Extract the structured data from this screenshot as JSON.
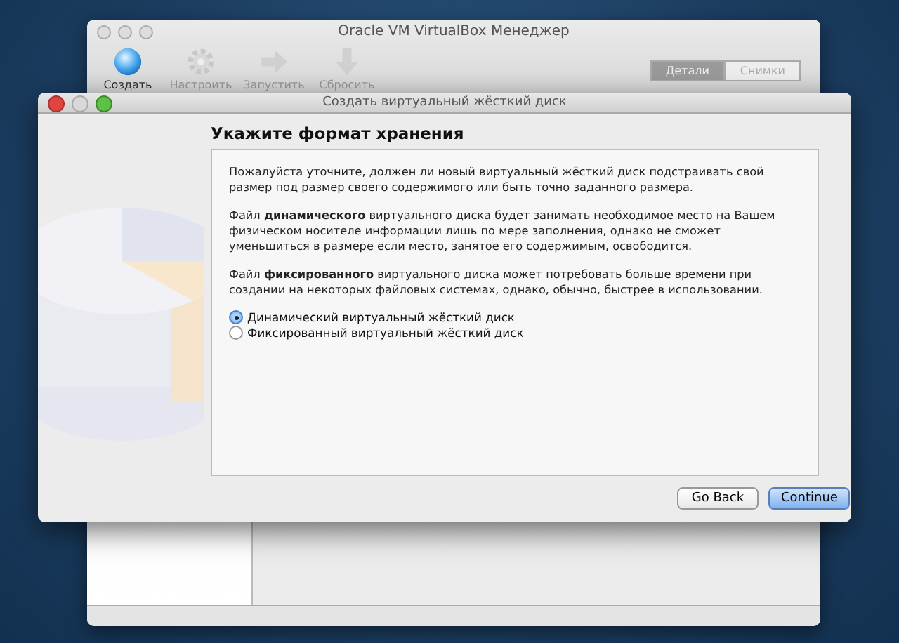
{
  "main_window": {
    "title": "Oracle VM VirtualBox Менеджер",
    "toolbar": [
      {
        "label": "Создать",
        "disabled": false
      },
      {
        "label": "Настроить",
        "disabled": true
      },
      {
        "label": "Запустить",
        "disabled": true
      },
      {
        "label": "Сбросить",
        "disabled": true
      }
    ],
    "segments": [
      {
        "label": "Детали",
        "selected": true
      },
      {
        "label": "Снимки",
        "selected": false
      }
    ]
  },
  "dialog": {
    "title": "Создать виртуальный жёсткий диск",
    "heading": "Укажите формат хранения",
    "paragraphs": [
      "Пожалуйста уточните, должен ли новый виртуальный жёсткий диск подстраивать свой размер под размер своего содержимого или быть точно заданного размера.",
      "Файл **динамического** виртуального диска будет занимать необходимое место на Вашем физическом носителе информации лишь по мере заполнения, однако не сможет уменьшиться в размере если место, занятое его содержимым, освободится.",
      "Файл **фиксированного** виртуального диска может потребовать больше времени при создании на некоторых файловых системах, однако, обычно, быстрее в использовании."
    ],
    "options": [
      {
        "label": "Динамический виртуальный жёсткий диск",
        "selected": true
      },
      {
        "label": "Фиксированный виртуальный жёсткий диск",
        "selected": false
      }
    ],
    "buttons": [
      {
        "label": "Go Back",
        "kind": "secondary"
      },
      {
        "label": "Continue",
        "kind": "primary"
      }
    ]
  }
}
